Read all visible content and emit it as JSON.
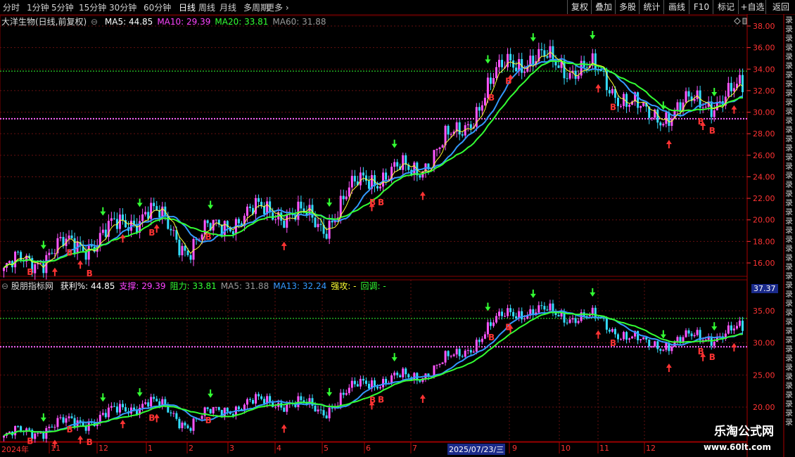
{
  "toolbar": {
    "timeframes": [
      "分时",
      "1分钟",
      "5分钟",
      "15分钟",
      "30分钟",
      "60分钟",
      "日线",
      "周线",
      "月线",
      "多周期",
      "更多"
    ],
    "active_timeframe": "日线",
    "more_arrow": "›",
    "buttons": [
      "复权",
      "叠加",
      "多股",
      "统计",
      "画线",
      "F10",
      "标记",
      "+自选",
      "返回"
    ]
  },
  "main_panel": {
    "title": "大洋生物(日线,前复权)",
    "ma": [
      {
        "label": "MA5: 44.85",
        "color": "#ffffff"
      },
      {
        "label": "MA10: 29.39",
        "color": "#ff44ff"
      },
      {
        "label": "MA20: 33.81",
        "color": "#33ff33"
      },
      {
        "label": "MA60: 31.88",
        "color": "#999999"
      }
    ],
    "price_axis": [
      "38.00",
      "36.00",
      "34.00",
      "32.00",
      "30.00",
      "28.00",
      "26.00",
      "24.00",
      "22.00",
      "20.00",
      "18.00",
      "16.00"
    ],
    "resistance": 33.81,
    "support": 29.39
  },
  "indicator_panel": {
    "title": "股朋指标网",
    "fields": [
      {
        "label": "获利%: 44.85",
        "color": "#ffffff"
      },
      {
        "label": "支撑: 29.39",
        "color": "#ff44ff"
      },
      {
        "label": "阻力: 33.81",
        "color": "#33ff33"
      },
      {
        "label": "MA5: 31.88",
        "color": "#999999"
      },
      {
        "label": "MA13: 32.24",
        "color": "#3399ff"
      },
      {
        "label": "强攻: -",
        "color": "#ffff33"
      },
      {
        "label": "回调: -",
        "color": "#33ff33"
      }
    ],
    "price_axis": [
      "35.00",
      "30.00",
      "25.00",
      "20.00"
    ],
    "current_price_box": "37.37"
  },
  "date_axis": {
    "labels": [
      "2024年",
      "11",
      "12",
      "1",
      "2",
      "3",
      "4",
      "5",
      "6",
      "7",
      "8",
      "9",
      "10",
      "11",
      "12"
    ],
    "highlight": "2025/07/23/三"
  },
  "marks": {
    "buy_letter": "B"
  },
  "watermark": {
    "name": "乐淘公式网",
    "url": "www.60lt.com"
  },
  "side_text": "录录录录录录录录录录录录录录录录录录录录录录录录录录录录录录录录录录录录录录录录录录录录录",
  "colors": {
    "up": "#ff55ff",
    "down": "#33ddff",
    "ma_blue": "#3399ff",
    "green": "#33ff33",
    "pink": "#ff66ff",
    "red": "#ff3333",
    "yellow": "#ffff33"
  },
  "chart_data": {
    "type": "candlestick",
    "x": [
      "2024-10",
      "2024-11",
      "2024-12",
      "2025-01",
      "2025-02",
      "2025-03",
      "2025-04",
      "2025-05",
      "2025-06",
      "2025-07",
      "2025-08",
      "2025-09",
      "2025-10",
      "2025-11",
      "2025-12"
    ],
    "close_monthly": [
      17.0,
      18.2,
      21.0,
      17.5,
      20.0,
      21.0,
      19.5,
      24.0,
      24.5,
      28.0,
      35.0,
      34.5,
      33.5,
      29.5,
      32.0
    ],
    "ylim": [
      15.0,
      38.5
    ],
    "lines": [
      {
        "name": "支撑",
        "value": 29.39
      },
      {
        "name": "阻力",
        "value": 33.81
      }
    ]
  }
}
